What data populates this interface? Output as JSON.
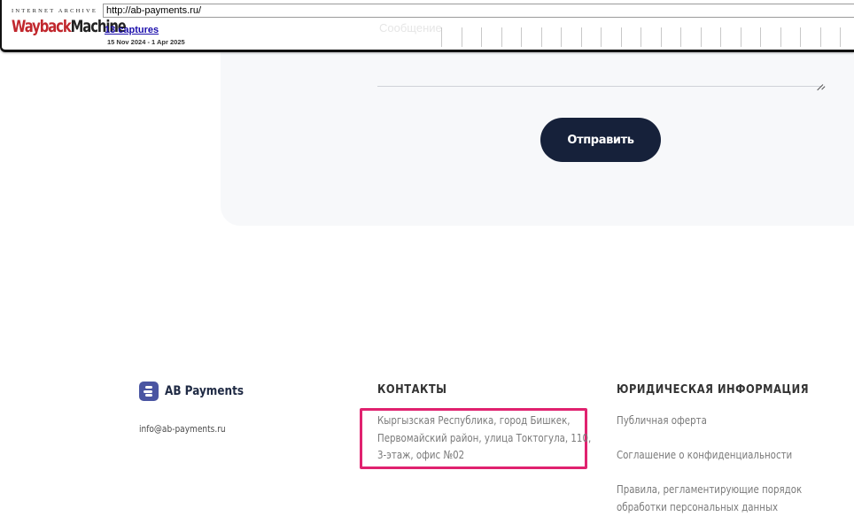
{
  "wayback": {
    "logo_top": "INTERNET ARCHIVE",
    "logo_word1": "Wayback",
    "logo_word2": "Machine",
    "url": "http://ab-payments.ru/",
    "captures": "13 captures",
    "date_range": "15 Nov 2024 - 1 Apr 2025"
  },
  "form": {
    "message_placeholder": "Сообщение",
    "submit_label": "Отправить"
  },
  "footer": {
    "brand_name": "AB Payments",
    "email": "info@ab-payments.ru",
    "contacts_title": "КОНТАКТЫ",
    "address_lines": [
      "Кыргызская Республика, город Бишкек,",
      "Первомайский район, улица Токтогула, 110,",
      "3-этаж, офис №02"
    ],
    "legal_title": "ЮРИДИЧЕСКАЯ ИНФОРМАЦИЯ",
    "legal_links": [
      "Публичная оферта",
      "Соглашение о конфиденциальности",
      "Правила, регламентирующие порядок",
      "обработки персональных данных"
    ]
  },
  "colors": {
    "button_bg": "#16213a",
    "highlight_border": "#e0226f",
    "brand_icon": "#4a55a2",
    "card_bg": "#f7f8fa"
  }
}
